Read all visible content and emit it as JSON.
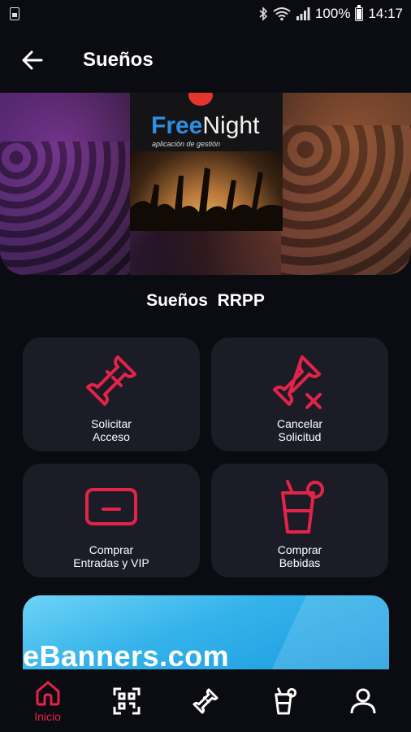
{
  "status_bar": {
    "battery_percent": "100%",
    "time": "14:17",
    "icons": [
      "sim-icon",
      "bluetooth-icon",
      "wifi-icon",
      "signal-icon",
      "battery-icon"
    ]
  },
  "app_bar": {
    "title": "Sueños",
    "back_icon": "back-arrow-icon"
  },
  "hero": {
    "logo_word_1": "Free",
    "logo_word_2": "Night",
    "logo_subtitle": "aplicación de gestión"
  },
  "venue": {
    "name": "Sueños  RRPP"
  },
  "actions": [
    {
      "label": "Solicitar\nAcceso",
      "icon": "ticket-icon"
    },
    {
      "label": "Cancelar\nSolicitud",
      "icon": "ticket-cancel-icon"
    },
    {
      "label": "Comprar\nEntradas y VIP",
      "icon": "credit-card-icon"
    },
    {
      "label": "Comprar\nBebidas",
      "icon": "drink-icon"
    }
  ],
  "ad": {
    "text": "eBanners.com"
  },
  "bottom_nav": {
    "items": [
      {
        "label": "Inicio",
        "icon": "home-icon",
        "active": true
      },
      {
        "label": "",
        "icon": "qr-code-icon",
        "active": false
      },
      {
        "label": "",
        "icon": "ticket-icon",
        "active": false
      },
      {
        "label": "",
        "icon": "drink-icon",
        "active": false
      },
      {
        "label": "",
        "icon": "user-icon",
        "active": false
      }
    ]
  },
  "colors": {
    "background": "#0b0b12",
    "card": "#1b1c26",
    "accent": "#e4234a",
    "ad_blue": "#33b2ea"
  }
}
